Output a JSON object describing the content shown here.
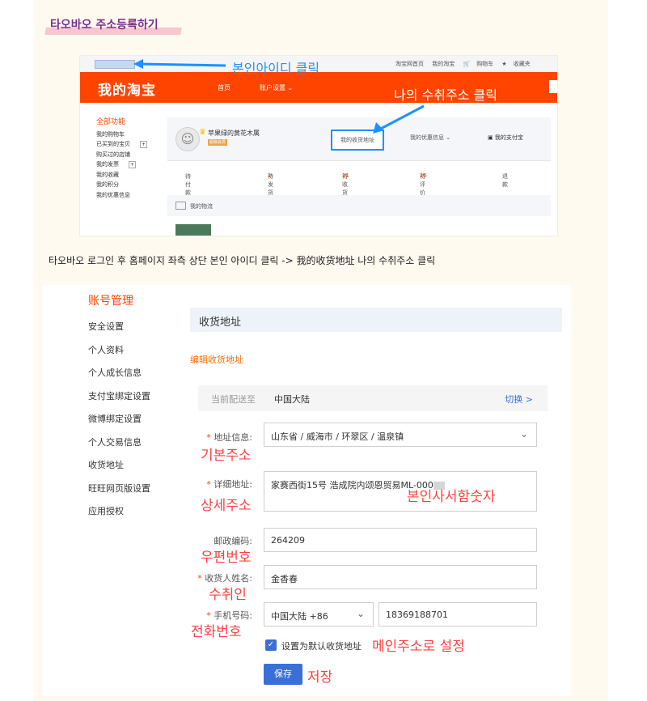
{
  "section_title": "타오바오 주소등록하기",
  "shot1": {
    "topbar_links": [
      "淘宝网首页",
      "我的淘宝",
      "购物车",
      "收藏夹"
    ],
    "logo": "我的淘宝",
    "nav": [
      "首页",
      "账户设置 ⌄"
    ],
    "left_menu_header": "全部功能",
    "left_menu": [
      "我的购物车",
      "已买到的宝贝",
      "购买过的店铺",
      "我的发票",
      "我的收藏",
      "我的积分",
      "我的优惠信息"
    ],
    "username": "苹果绿的黄花木属",
    "vip_label": "超级会员",
    "address_link": "我的收货地址",
    "coupon_link": "我的优惠信息 ⌄",
    "alipay_link": "我的支付宝",
    "orders": [
      {
        "label": "待付款",
        "count": ""
      },
      {
        "label": "待发货",
        "count": "1"
      },
      {
        "label": "待收货",
        "count": "11"
      },
      {
        "label": "待评价",
        "count": "15"
      },
      {
        "label": "退款",
        "count": ""
      }
    ],
    "logistics": "我的物流",
    "annotation_id": "본인아이디 클릭",
    "annotation_addr": "나의 수취주소 클릭",
    "accent": "#ff4400",
    "annotation_color": "#1e90ff"
  },
  "caption": "타오바오 로그인 후 홈페이지 좌측 상단 본인 아이디 클릭 -> 我的收货地址 나의 수취주소 클릭",
  "shot2": {
    "side_header": "账号管理",
    "side_menu": [
      "安全设置",
      "个人资料",
      "个人成长信息",
      "支付宝绑定设置",
      "微博绑定设置",
      "个人交易信息",
      "收货地址",
      "旺旺网页版设置",
      "应用授权"
    ],
    "header": "收货地址",
    "edit_title": "编辑收货地址",
    "current_label": "当前配送至",
    "current_value": "中国大陆",
    "switch_label": "切换 >",
    "region_label": "地址信息:",
    "region_value": "山东省 / 威海市 / 环翠区 / 温泉镇",
    "detail_label": "详细地址:",
    "detail_value": "家赛西街15号 浩成院内颂恩贸易ML-000",
    "zip_label": "邮政编码:",
    "zip_value": "264209",
    "name_label": "收货人姓名:",
    "name_value": "金香春",
    "phone_label": "手机号码:",
    "phone_country": "中国大陆 +86",
    "phone_value": "18369188701",
    "default_label": "设置为默认收货地址",
    "save_label": "保存",
    "annotations": {
      "region": "기본주소",
      "detail": "상세주소",
      "detail_note": "본인사서함숫자",
      "zip": "우편번호",
      "name": "수취인",
      "phone": "전화번호",
      "default": "메인주소로 설정",
      "save": "저장"
    },
    "link_color": "#3a6fd8",
    "annotation_color": "#ff4040"
  }
}
